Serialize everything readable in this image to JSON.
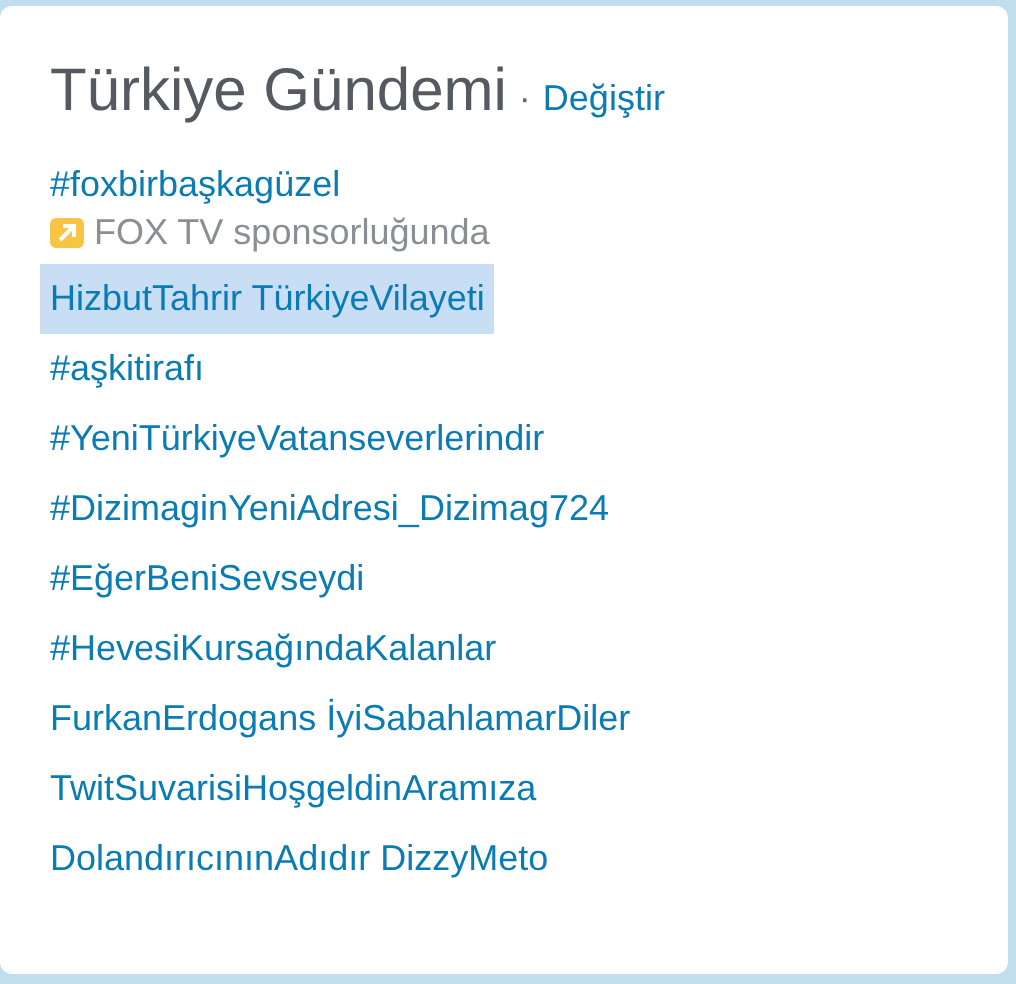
{
  "header": {
    "title": "Türkiye Gündemi",
    "separator": "·",
    "change_link": "Değiştir"
  },
  "trends": [
    {
      "label": "#foxbirbaşkagüzel",
      "selected": false,
      "kind": "promoted",
      "sponsor": "FOX TV sponsorluğunda"
    },
    {
      "label": "HizbutTahrir TürkiyeVilayeti",
      "selected": true,
      "kind": "plain"
    },
    {
      "label": "#aşkitirafı",
      "selected": false,
      "kind": "plain"
    },
    {
      "label": "#YeniTürkiyeVatanseverlerindir",
      "selected": false,
      "kind": "plain"
    },
    {
      "label": "#DizimaginYeniAdresi_Dizimag724",
      "selected": false,
      "kind": "plain"
    },
    {
      "label": "#EğerBeniSevseydi",
      "selected": false,
      "kind": "plain"
    },
    {
      "label": "#HevesiKursağındaKalanlar",
      "selected": false,
      "kind": "plain"
    },
    {
      "label": "FurkanErdogans İyiSabahlamarDiler",
      "selected": false,
      "kind": "plain"
    },
    {
      "label": "TwitSuvarisiHoşgeldinAramıza",
      "selected": false,
      "kind": "plain"
    },
    {
      "label": "DolandırıcınınAdıdır DizzyMeto",
      "selected": false,
      "kind": "plain"
    }
  ]
}
